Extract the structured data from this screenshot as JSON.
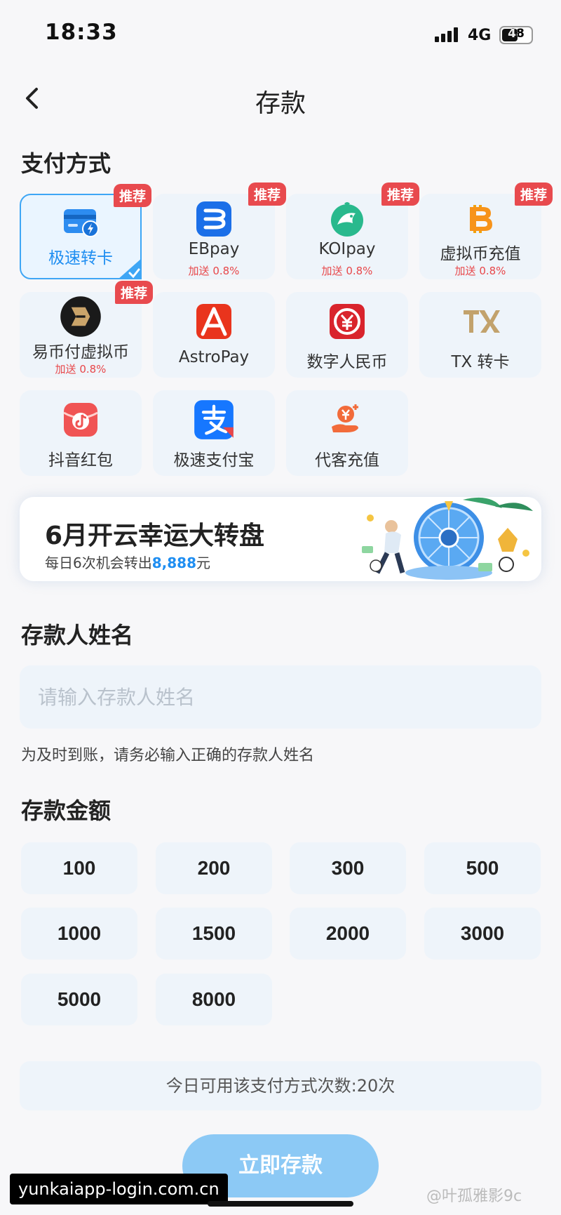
{
  "status_bar": {
    "time": "18:33",
    "network": "4G",
    "battery": "48"
  },
  "nav": {
    "title": "存款"
  },
  "payment": {
    "section_title": "支付方式",
    "methods": [
      {
        "name": "极速转卡",
        "badge": "推荐",
        "bonus": "",
        "icon": "card-flash-icon",
        "selected": true
      },
      {
        "name": "EBpay",
        "badge": "推荐",
        "bonus": "加送 0.8%",
        "icon": "ebpay-icon"
      },
      {
        "name": "KOIpay",
        "badge": "推荐",
        "bonus": "加送 0.8%",
        "icon": "koi-fish-icon"
      },
      {
        "name": "虚拟币充值",
        "badge": "推荐",
        "bonus": "加送 0.8%",
        "icon": "bitcoin-icon"
      },
      {
        "name": "易币付虚拟币",
        "badge": "推荐",
        "bonus": "加送 0.8%",
        "icon": "ebifu-icon"
      },
      {
        "name": "AstroPay",
        "badge": "",
        "bonus": "",
        "icon": "astropay-icon"
      },
      {
        "name": "数字人民币",
        "badge": "",
        "bonus": "",
        "icon": "digital-rmb-icon"
      },
      {
        "name": "TX 转卡",
        "badge": "",
        "bonus": "",
        "icon": "tx-icon"
      },
      {
        "name": "抖音红包",
        "badge": "",
        "bonus": "",
        "icon": "douyin-redpacket-icon"
      },
      {
        "name": "极速支付宝",
        "badge": "",
        "bonus": "",
        "icon": "alipay-icon"
      },
      {
        "name": "代客充值",
        "badge": "",
        "bonus": "",
        "icon": "agent-recharge-icon"
      }
    ]
  },
  "banner": {
    "title": "6月开云幸运大转盘",
    "subtitle_prefix": "每日6次机会转出",
    "subtitle_amount": "8,888",
    "subtitle_suffix": "元"
  },
  "depositor": {
    "section_title": "存款人姓名",
    "placeholder": "请输入存款人姓名",
    "value": "",
    "hint": "为及时到账，请务必输入正确的存款人姓名"
  },
  "amount": {
    "section_title": "存款金额",
    "options": [
      "100",
      "200",
      "300",
      "500",
      "1000",
      "1500",
      "2000",
      "3000",
      "5000",
      "8000"
    ]
  },
  "usage_text": "今日可用该支付方式次数:20次",
  "submit_label": "立即存款",
  "watermark": {
    "url": "yunkaiapp-login.com.cn",
    "author": "@叶孤雅影9c"
  },
  "colors": {
    "accent": "#1f8ef1",
    "badge": "#e84a4e",
    "card_bg": "#eef4fa",
    "submit": "#8cc9f5"
  }
}
